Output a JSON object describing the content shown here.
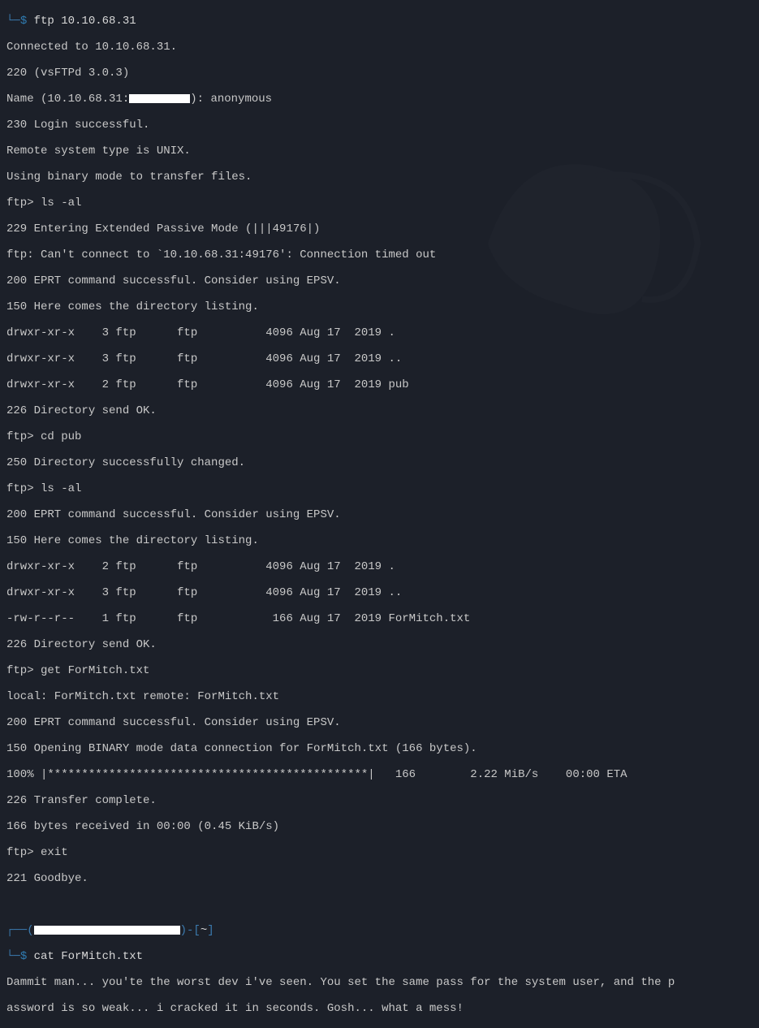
{
  "prompt1": {
    "glyph_open": "└─",
    "dollar": "$",
    "cmd": " ftp 10.10.68.31"
  },
  "ftp": {
    "l01": "Connected to 10.10.68.31.",
    "l02": "220 (vsFTPd 3.0.3)",
    "l03a": "Name (10.10.68.31:",
    "l03b": "): anonymous",
    "l04": "230 Login successful.",
    "l05": "Remote system type is UNIX.",
    "l06": "Using binary mode to transfer files.",
    "l07": "ftp> ls -al",
    "l08": "229 Entering Extended Passive Mode (|||49176|)",
    "l09": "ftp: Can't connect to `10.10.68.31:49176': Connection timed out",
    "l10": "200 EPRT command successful. Consider using EPSV.",
    "l11": "150 Here comes the directory listing.",
    "l12": "drwxr-xr-x    3 ftp      ftp          4096 Aug 17  2019 .",
    "l13": "drwxr-xr-x    3 ftp      ftp          4096 Aug 17  2019 ..",
    "l14": "drwxr-xr-x    2 ftp      ftp          4096 Aug 17  2019 pub",
    "l15": "226 Directory send OK.",
    "l16": "ftp> cd pub",
    "l17": "250 Directory successfully changed.",
    "l18": "ftp> ls -al",
    "l19": "200 EPRT command successful. Consider using EPSV.",
    "l20": "150 Here comes the directory listing.",
    "l21": "drwxr-xr-x    2 ftp      ftp          4096 Aug 17  2019 .",
    "l22": "drwxr-xr-x    3 ftp      ftp          4096 Aug 17  2019 ..",
    "l23": "-rw-r--r--    1 ftp      ftp           166 Aug 17  2019 ForMitch.txt",
    "l24": "226 Directory send OK.",
    "l25": "ftp> get ForMitch.txt",
    "l26": "local: ForMitch.txt remote: ForMitch.txt",
    "l27": "200 EPRT command successful. Consider using EPSV.",
    "l28": "150 Opening BINARY mode data connection for ForMitch.txt (166 bytes).",
    "l29": "100% |***********************************************|   166        2.22 MiB/s    00:00 ETA",
    "l30": "226 Transfer complete.",
    "l31": "166 bytes received in 00:00 (0.45 KiB/s)",
    "l32": "ftp> exit",
    "l33": "221 Goodbye."
  },
  "prompt2": {
    "top_open": "┌──",
    "top_openparen": "(",
    "top_closeparen": ")",
    "top_dash_open": "-[",
    "home": "~",
    "top_dash_close": "]",
    "bot_open": "└─",
    "dollar": "$",
    "cmd": " cat ForMitch.txt"
  },
  "cat": {
    "l1": "Dammit man... you'te the worst dev i've seen. You set the same pass for the system user, and the p",
    "l2": "assword is so weak... i cracked it in seconds. Gosh... what a mess!"
  }
}
